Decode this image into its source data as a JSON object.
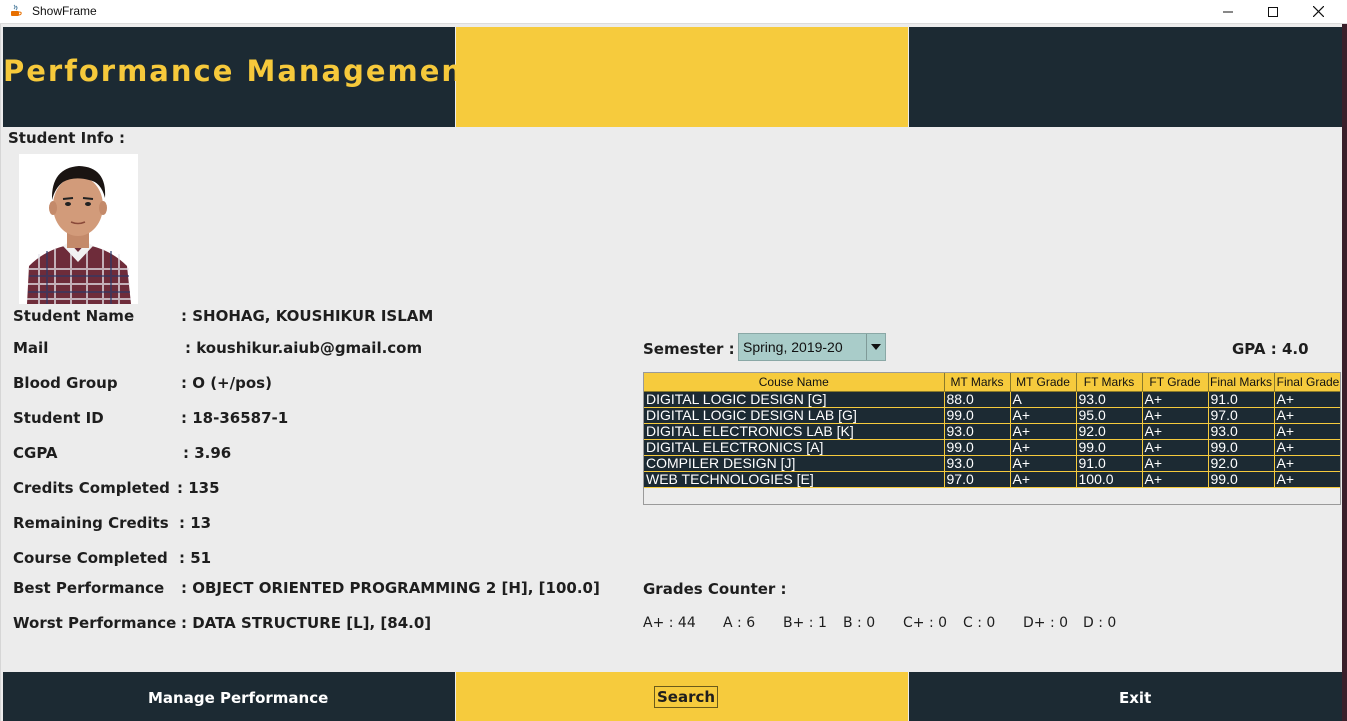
{
  "window": {
    "title": "ShowFrame"
  },
  "header": {
    "title": "Performance Management"
  },
  "student_info_label": "Student Info :",
  "student_fields": [
    {
      "label": "Student Name",
      "value": ": SHOHAG, KOUSHIKUR ISLAM"
    },
    {
      "label": "Mail",
      "value": ": koushikur.aiub@gmail.com"
    },
    {
      "label": "Blood Group",
      "value": ": O (+/pos)"
    },
    {
      "label": "Student ID",
      "value": ": 18-36587-1"
    },
    {
      "label": "CGPA",
      "value": ": 3.96"
    },
    {
      "label": "Credits Completed",
      "value": ": 135"
    },
    {
      "label": "Remaining Credits",
      "value": ": 13"
    },
    {
      "label": "Course Completed",
      "value": ": 51"
    },
    {
      "label": "Best Performance",
      "value": ": OBJECT ORIENTED PROGRAMMING 2 [H], [100.0]"
    },
    {
      "label": "Worst Performance",
      "value": ": DATA STRUCTURE [L], [84.0]"
    }
  ],
  "semester": {
    "label": "Semester  :",
    "selected": "Spring, 2019-20"
  },
  "gpa": {
    "label": "GPA : 4.0"
  },
  "table": {
    "headers": [
      "Couse Name",
      "MT Marks",
      "MT Grade",
      "FT Marks",
      "FT Grade",
      "Final Marks",
      "Final Grade"
    ],
    "rows": [
      [
        "DIGITAL LOGIC DESIGN [G]",
        "88.0",
        "A",
        "93.0",
        "A+",
        "91.0",
        "A+"
      ],
      [
        "DIGITAL LOGIC DESIGN LAB [G]",
        "99.0",
        "A+",
        "95.0",
        "A+",
        "97.0",
        "A+"
      ],
      [
        "DIGITAL ELECTRONICS LAB [K]",
        "93.0",
        "A+",
        "92.0",
        "A+",
        "93.0",
        "A+"
      ],
      [
        "DIGITAL ELECTRONICS [A]",
        "99.0",
        "A+",
        "99.0",
        "A+",
        "99.0",
        "A+"
      ],
      [
        "COMPILER DESIGN [J]",
        "93.0",
        "A+",
        "91.0",
        "A+",
        "92.0",
        "A+"
      ],
      [
        "WEB TECHNOLOGIES [E]",
        "97.0",
        "A+",
        "100.0",
        "A+",
        "99.0",
        "A+"
      ]
    ]
  },
  "grades_counter": {
    "label": "Grades Counter :",
    "items": [
      "A+ : 44",
      "A : 6",
      "B+ : 1",
      "B : 0",
      "C+ : 0",
      "C : 0",
      "D+ : 0",
      "D : 0"
    ]
  },
  "footer": {
    "manage_label": "Manage Performance",
    "search_label": "Search",
    "exit_label": "Exit"
  },
  "colors": {
    "dark": "#1c2a33",
    "accent": "#f6cb3d",
    "combo": "#a9ccc9"
  }
}
